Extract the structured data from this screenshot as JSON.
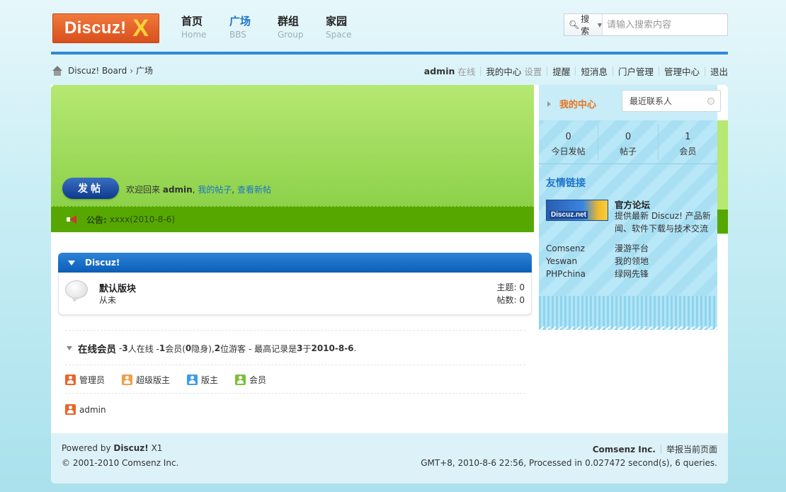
{
  "header": {
    "logo_text": "Discuz!",
    "logo_mark": "X",
    "nav": [
      {
        "zh": "首页",
        "en": "Home"
      },
      {
        "zh": "广场",
        "en": "BBS"
      },
      {
        "zh": "群组",
        "en": "Group"
      },
      {
        "zh": "家园",
        "en": "Space"
      }
    ],
    "search": {
      "type_label": "搜索",
      "placeholder": "请输入搜索内容"
    }
  },
  "breadcrumb": {
    "root": "Discuz! Board",
    "sep": "›",
    "current": "广场"
  },
  "userbar": {
    "username": "admin",
    "status": "在线",
    "my_center": "我的中心",
    "settings": "设置",
    "remind": "提醒",
    "messages": "短消息",
    "portal_admin": "门户管理",
    "admin_center": "管理中心",
    "logout": "退出"
  },
  "banner": {
    "post_button": "发帖",
    "welcome_prefix": "欢迎回来",
    "welcome_user": "admin",
    "link_my_posts": "我的帖子",
    "link_new_posts": "查看新帖"
  },
  "notice": {
    "label": "公告:",
    "text": "xxxx(2010-8-6)"
  },
  "sidebar": {
    "my_center": "我的中心",
    "recent_contacts": "最近联系人",
    "stats": [
      {
        "num": "0",
        "label": "今日发帖"
      },
      {
        "num": "0",
        "label": "帖子"
      },
      {
        "num": "1",
        "label": "会员"
      }
    ],
    "friends_title": "友情链接",
    "official": {
      "badge": "Discuz.net",
      "title": "官方论坛",
      "desc": "提供最新 Discuz! 产品新闻、软件下载与技术交流"
    },
    "links": [
      {
        "a": "Comsenz",
        "b": "漫游平台"
      },
      {
        "a": "Yeswan",
        "b": "我的领地"
      },
      {
        "a": "PHPchina",
        "b": "绿网先锋"
      }
    ]
  },
  "forum": {
    "category": "Discuz!",
    "board_name": "默认版块",
    "last_post": "从未",
    "topics_label": "主题: 0",
    "posts_label": "帖数: 0"
  },
  "online": {
    "title": "在线会员",
    "summary_1": "- ",
    "n_online": "3",
    "summary_2": " 人在线 - ",
    "n_members": "1",
    "summary_3": " 会员(",
    "n_hidden": "0",
    "summary_4": " 隐身), ",
    "n_guests": "2",
    "summary_5": " 位游客 - 最高记录是 ",
    "n_record": "3",
    "summary_6": " 于 ",
    "record_date": "2010-8-6",
    "summary_7": ".",
    "legend": [
      {
        "label": "管理员",
        "color": "#e8662a"
      },
      {
        "label": "超级版主",
        "color": "#f0a04a"
      },
      {
        "label": "版主",
        "color": "#3d9ee4"
      },
      {
        "label": "会员",
        "color": "#7cc13a"
      }
    ],
    "user": "admin"
  },
  "footer": {
    "powered_prefix": "Powered by",
    "powered_name": "Discuz!",
    "powered_ver": "X1",
    "copyright": "© 2001-2010 Comsenz Inc.",
    "company": "Comsenz Inc.",
    "report": "举报当前页面",
    "runtime": "GMT+8, 2010-8-6 22:56, Processed in 0.027472 second(s), 6 queries."
  }
}
